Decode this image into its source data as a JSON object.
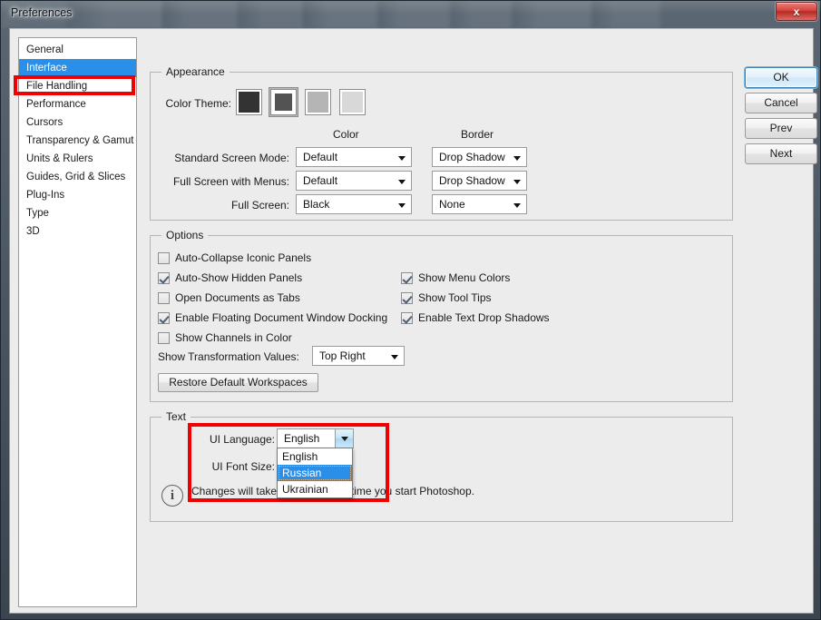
{
  "window": {
    "title": "Preferences",
    "close_label": "x"
  },
  "sidebar": {
    "items": [
      {
        "label": "General",
        "selected": false
      },
      {
        "label": "Interface",
        "selected": true
      },
      {
        "label": "File Handling",
        "selected": false
      },
      {
        "label": "Performance",
        "selected": false
      },
      {
        "label": "Cursors",
        "selected": false
      },
      {
        "label": "Transparency & Gamut",
        "selected": false
      },
      {
        "label": "Units & Rulers",
        "selected": false
      },
      {
        "label": "Guides, Grid & Slices",
        "selected": false
      },
      {
        "label": "Plug-Ins",
        "selected": false
      },
      {
        "label": "Type",
        "selected": false
      },
      {
        "label": "3D",
        "selected": false
      }
    ]
  },
  "appearance": {
    "group_title": "Appearance",
    "color_theme_label": "Color Theme:",
    "swatches": [
      {
        "color": "#333333",
        "selected": false
      },
      {
        "color": "#535353",
        "selected": true
      },
      {
        "color": "#b5b5b5",
        "selected": false
      },
      {
        "color": "#d8d8d8",
        "selected": false
      }
    ],
    "col_color_header": "Color",
    "col_border_header": "Border",
    "rows": [
      {
        "label": "Standard Screen Mode:",
        "color": "Default",
        "border": "Drop Shadow"
      },
      {
        "label": "Full Screen with Menus:",
        "color": "Default",
        "border": "Drop Shadow"
      },
      {
        "label": "Full Screen:",
        "color": "Black",
        "border": "None"
      }
    ]
  },
  "options": {
    "group_title": "Options",
    "left_checkboxes": [
      {
        "label": "Auto-Collapse Iconic Panels",
        "checked": false
      },
      {
        "label": "Auto-Show Hidden Panels",
        "checked": true
      },
      {
        "label": "Open Documents as Tabs",
        "checked": false
      },
      {
        "label": "Enable Floating Document Window Docking",
        "checked": true
      },
      {
        "label": "Show Channels in Color",
        "checked": false
      }
    ],
    "right_checkboxes": [
      {
        "label": "Show Menu Colors",
        "checked": true
      },
      {
        "label": "Show Tool Tips",
        "checked": true
      },
      {
        "label": "Enable Text Drop Shadows",
        "checked": true
      }
    ],
    "transformation_label": "Show Transformation Values:",
    "transformation_value": "Top Right",
    "restore_button": "Restore Default Workspaces"
  },
  "text_section": {
    "group_title": "Text",
    "ui_language_label": "UI Language:",
    "ui_language_value": "English",
    "ui_language_options": [
      {
        "label": "English",
        "highlighted": false
      },
      {
        "label": "Russian",
        "highlighted": true
      },
      {
        "label": "Ukrainian",
        "highlighted": false
      }
    ],
    "ui_font_size_label": "UI Font Size:",
    "note": "Changes will take effect the next time you start Photoshop.",
    "info_icon_glyph": "i"
  },
  "buttons": {
    "ok": "OK",
    "cancel": "Cancel",
    "prev": "Prev",
    "next": "Next"
  },
  "colors": {
    "selection_blue": "#2a8fe8",
    "annotation_red": "#f00000",
    "dialog_bg": "#ececec"
  }
}
